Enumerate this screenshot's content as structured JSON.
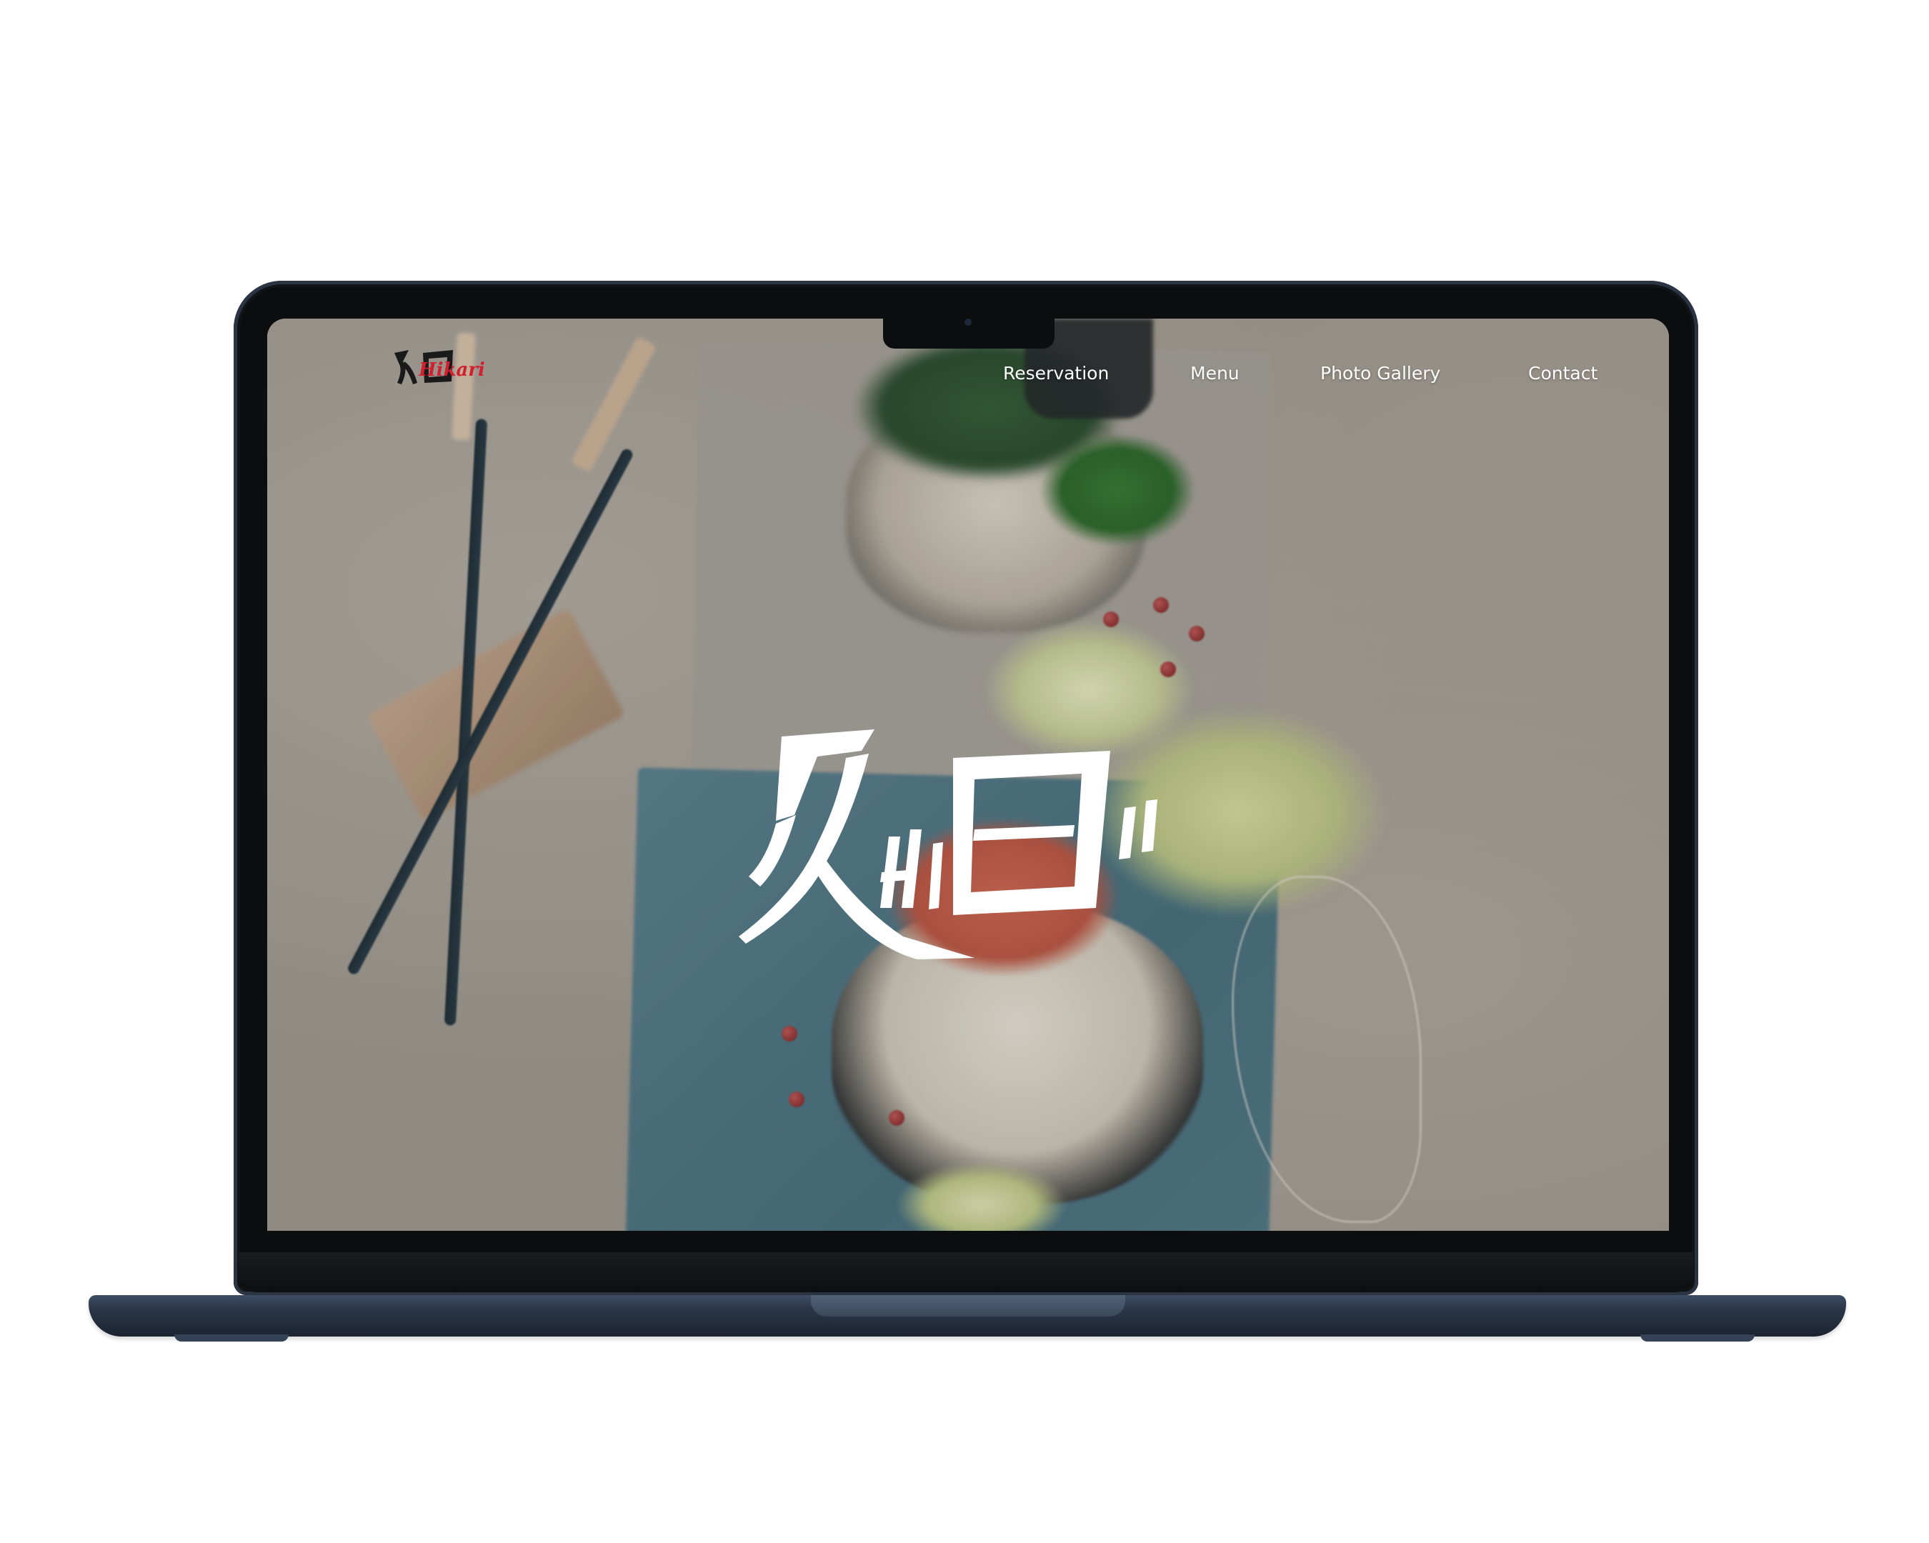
{
  "site": {
    "logo": {
      "text": "Hikari",
      "accent_color": "#d3202f",
      "ink_color": "#1a1a1a"
    },
    "nav": {
      "items": [
        {
          "label": "Reservation"
        },
        {
          "label": "Menu"
        },
        {
          "label": "Photo Gallery"
        },
        {
          "label": "Contact"
        }
      ]
    },
    "hero": {
      "logo_color": "#ffffff"
    }
  },
  "device": {
    "frame_color": "#1b2331"
  }
}
